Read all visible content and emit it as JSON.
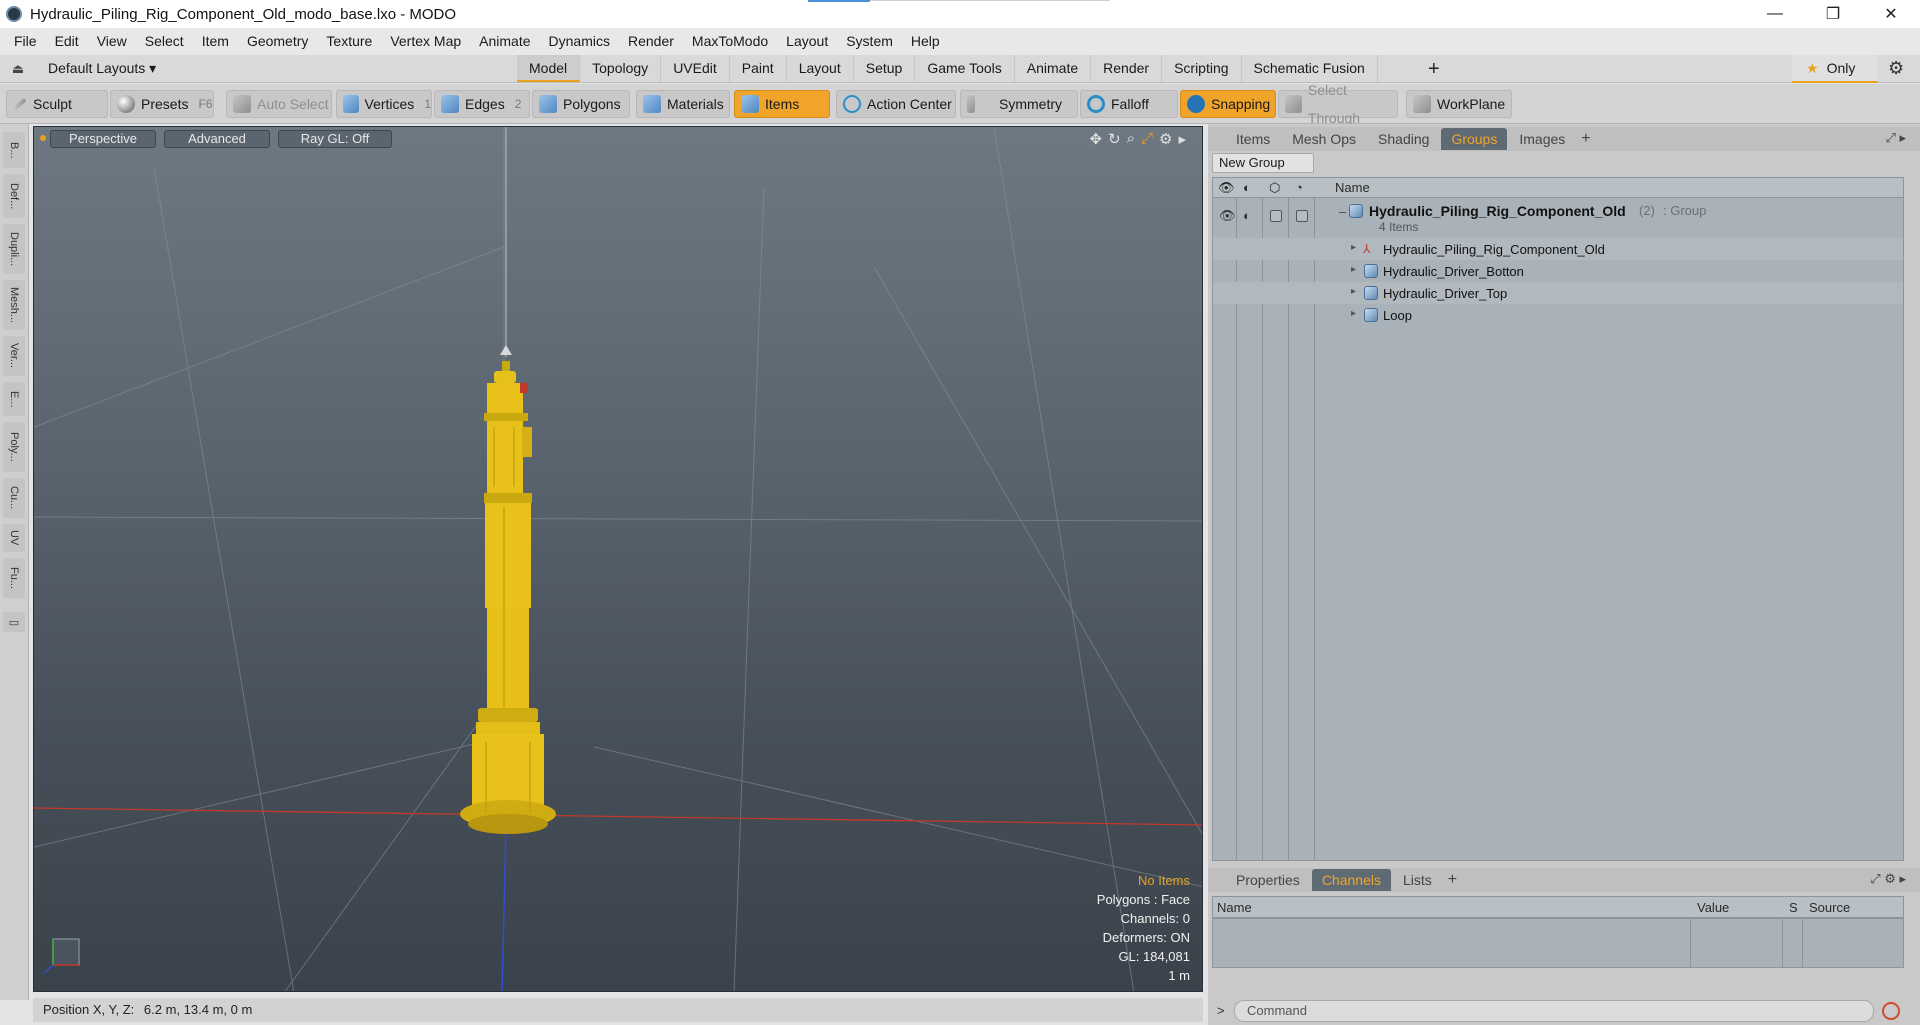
{
  "window": {
    "title": "Hydraulic_Piling_Rig_Component_Old_modo_base.lxo - MODO",
    "controls": [
      "—",
      "❐",
      "✕"
    ]
  },
  "menu": [
    "File",
    "Edit",
    "View",
    "Select",
    "Item",
    "Geometry",
    "Texture",
    "Vertex Map",
    "Animate",
    "Dynamics",
    "Render",
    "MaxToModo",
    "Layout",
    "System",
    "Help"
  ],
  "layoutbar": {
    "layouts_label": "Default Layouts ▾",
    "tabs": [
      "Model",
      "Topology",
      "UVEdit",
      "Paint",
      "Layout",
      "Setup",
      "Game Tools",
      "Animate",
      "Render",
      "Scripting",
      "Schematic Fusion"
    ],
    "active_tab": "Model",
    "plus": "+",
    "only_label": "Only",
    "only_star": "★"
  },
  "toolbar": {
    "sculpt": "Sculpt",
    "presets": "Presets",
    "presets_key": "F6",
    "auto_select": "Auto Select",
    "vertices": "Vertices",
    "vertices_count": "1",
    "edges": "Edges",
    "edges_count": "2",
    "polygons": "Polygons",
    "materials": "Materials",
    "items": "Items",
    "action_center": "Action Center",
    "symmetry": "Symmetry",
    "falloff": "Falloff",
    "snapping": "Snapping",
    "select_through": "Select Through",
    "workplane": "WorkPlane"
  },
  "leftstrip": [
    "B...",
    "Def...",
    "Dupli...",
    "Mesh...",
    "Ver...",
    "E...",
    "Poly...",
    "Cu...",
    "UV",
    "Fu..."
  ],
  "viewport": {
    "perspective": "Perspective",
    "advanced": "Advanced",
    "raygl": "Ray GL: Off",
    "stats": {
      "no_items": "No Items",
      "polygons": "Polygons : Face",
      "channels": "Channels: 0",
      "deformers": "Deformers: ON",
      "gl": "GL: 184,081",
      "scale": "1 m"
    },
    "colors": {
      "model": "#e8c21a",
      "grid_x_axis": "#c0392b",
      "grid_z_axis": "#2d4fd0"
    }
  },
  "statusbar": {
    "position_label": "Position X, Y, Z:",
    "position_value": "6.2 m, 13.4 m, 0 m"
  },
  "groups_panel": {
    "tabs": [
      "Items",
      "Mesh Ops",
      "Shading",
      "Groups",
      "Images"
    ],
    "active_tab": "Groups",
    "new_group": "New Group",
    "name_header": "Name",
    "group": {
      "name": "Hydraulic_Piling_Rig_Component_Old",
      "suffix_count": "(2)",
      "suffix_type": ": Group",
      "count_label": "4 Items",
      "children": [
        {
          "name": "Hydraulic_Piling_Rig_Component_Old",
          "kind": "locator-icon"
        },
        {
          "name": "Hydraulic_Driver_Botton",
          "kind": "mesh-icon"
        },
        {
          "name": "Hydraulic_Driver_Top",
          "kind": "mesh-icon"
        },
        {
          "name": "Loop",
          "kind": "mesh-icon"
        }
      ]
    }
  },
  "channels_panel": {
    "tabs": [
      "Properties",
      "Channels",
      "Lists"
    ],
    "active_tab": "Channels",
    "columns": [
      "Name",
      "Value",
      "S",
      "Source"
    ]
  },
  "command": {
    "prompt": ">",
    "placeholder": "Command"
  }
}
